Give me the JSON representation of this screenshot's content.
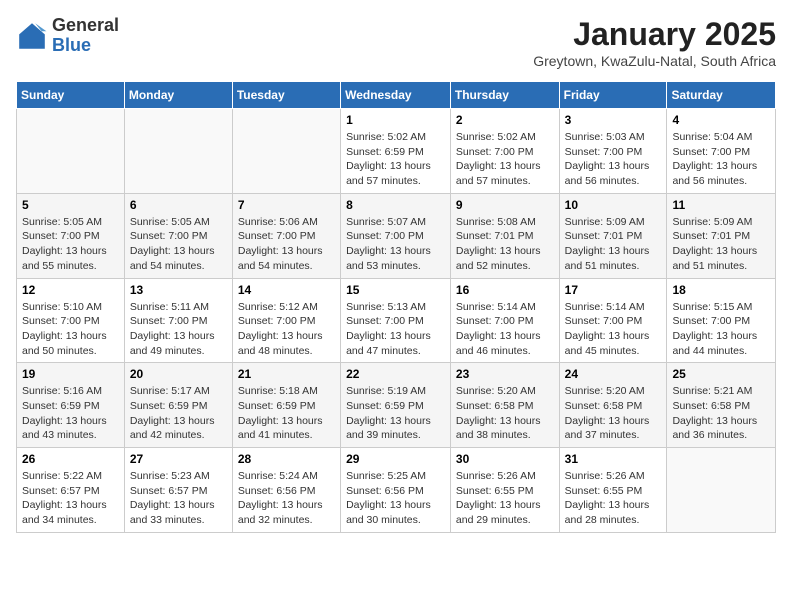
{
  "header": {
    "logo_general": "General",
    "logo_blue": "Blue",
    "title": "January 2025",
    "subtitle": "Greytown, KwaZulu-Natal, South Africa"
  },
  "weekdays": [
    "Sunday",
    "Monday",
    "Tuesday",
    "Wednesday",
    "Thursday",
    "Friday",
    "Saturday"
  ],
  "weeks": [
    [
      {
        "day": "",
        "info": ""
      },
      {
        "day": "",
        "info": ""
      },
      {
        "day": "",
        "info": ""
      },
      {
        "day": "1",
        "info": "Sunrise: 5:02 AM\nSunset: 6:59 PM\nDaylight: 13 hours\nand 57 minutes."
      },
      {
        "day": "2",
        "info": "Sunrise: 5:02 AM\nSunset: 7:00 PM\nDaylight: 13 hours\nand 57 minutes."
      },
      {
        "day": "3",
        "info": "Sunrise: 5:03 AM\nSunset: 7:00 PM\nDaylight: 13 hours\nand 56 minutes."
      },
      {
        "day": "4",
        "info": "Sunrise: 5:04 AM\nSunset: 7:00 PM\nDaylight: 13 hours\nand 56 minutes."
      }
    ],
    [
      {
        "day": "5",
        "info": "Sunrise: 5:05 AM\nSunset: 7:00 PM\nDaylight: 13 hours\nand 55 minutes."
      },
      {
        "day": "6",
        "info": "Sunrise: 5:05 AM\nSunset: 7:00 PM\nDaylight: 13 hours\nand 54 minutes."
      },
      {
        "day": "7",
        "info": "Sunrise: 5:06 AM\nSunset: 7:00 PM\nDaylight: 13 hours\nand 54 minutes."
      },
      {
        "day": "8",
        "info": "Sunrise: 5:07 AM\nSunset: 7:00 PM\nDaylight: 13 hours\nand 53 minutes."
      },
      {
        "day": "9",
        "info": "Sunrise: 5:08 AM\nSunset: 7:01 PM\nDaylight: 13 hours\nand 52 minutes."
      },
      {
        "day": "10",
        "info": "Sunrise: 5:09 AM\nSunset: 7:01 PM\nDaylight: 13 hours\nand 51 minutes."
      },
      {
        "day": "11",
        "info": "Sunrise: 5:09 AM\nSunset: 7:01 PM\nDaylight: 13 hours\nand 51 minutes."
      }
    ],
    [
      {
        "day": "12",
        "info": "Sunrise: 5:10 AM\nSunset: 7:00 PM\nDaylight: 13 hours\nand 50 minutes."
      },
      {
        "day": "13",
        "info": "Sunrise: 5:11 AM\nSunset: 7:00 PM\nDaylight: 13 hours\nand 49 minutes."
      },
      {
        "day": "14",
        "info": "Sunrise: 5:12 AM\nSunset: 7:00 PM\nDaylight: 13 hours\nand 48 minutes."
      },
      {
        "day": "15",
        "info": "Sunrise: 5:13 AM\nSunset: 7:00 PM\nDaylight: 13 hours\nand 47 minutes."
      },
      {
        "day": "16",
        "info": "Sunrise: 5:14 AM\nSunset: 7:00 PM\nDaylight: 13 hours\nand 46 minutes."
      },
      {
        "day": "17",
        "info": "Sunrise: 5:14 AM\nSunset: 7:00 PM\nDaylight: 13 hours\nand 45 minutes."
      },
      {
        "day": "18",
        "info": "Sunrise: 5:15 AM\nSunset: 7:00 PM\nDaylight: 13 hours\nand 44 minutes."
      }
    ],
    [
      {
        "day": "19",
        "info": "Sunrise: 5:16 AM\nSunset: 6:59 PM\nDaylight: 13 hours\nand 43 minutes."
      },
      {
        "day": "20",
        "info": "Sunrise: 5:17 AM\nSunset: 6:59 PM\nDaylight: 13 hours\nand 42 minutes."
      },
      {
        "day": "21",
        "info": "Sunrise: 5:18 AM\nSunset: 6:59 PM\nDaylight: 13 hours\nand 41 minutes."
      },
      {
        "day": "22",
        "info": "Sunrise: 5:19 AM\nSunset: 6:59 PM\nDaylight: 13 hours\nand 39 minutes."
      },
      {
        "day": "23",
        "info": "Sunrise: 5:20 AM\nSunset: 6:58 PM\nDaylight: 13 hours\nand 38 minutes."
      },
      {
        "day": "24",
        "info": "Sunrise: 5:20 AM\nSunset: 6:58 PM\nDaylight: 13 hours\nand 37 minutes."
      },
      {
        "day": "25",
        "info": "Sunrise: 5:21 AM\nSunset: 6:58 PM\nDaylight: 13 hours\nand 36 minutes."
      }
    ],
    [
      {
        "day": "26",
        "info": "Sunrise: 5:22 AM\nSunset: 6:57 PM\nDaylight: 13 hours\nand 34 minutes."
      },
      {
        "day": "27",
        "info": "Sunrise: 5:23 AM\nSunset: 6:57 PM\nDaylight: 13 hours\nand 33 minutes."
      },
      {
        "day": "28",
        "info": "Sunrise: 5:24 AM\nSunset: 6:56 PM\nDaylight: 13 hours\nand 32 minutes."
      },
      {
        "day": "29",
        "info": "Sunrise: 5:25 AM\nSunset: 6:56 PM\nDaylight: 13 hours\nand 30 minutes."
      },
      {
        "day": "30",
        "info": "Sunrise: 5:26 AM\nSunset: 6:55 PM\nDaylight: 13 hours\nand 29 minutes."
      },
      {
        "day": "31",
        "info": "Sunrise: 5:26 AM\nSunset: 6:55 PM\nDaylight: 13 hours\nand 28 minutes."
      },
      {
        "day": "",
        "info": ""
      }
    ]
  ]
}
